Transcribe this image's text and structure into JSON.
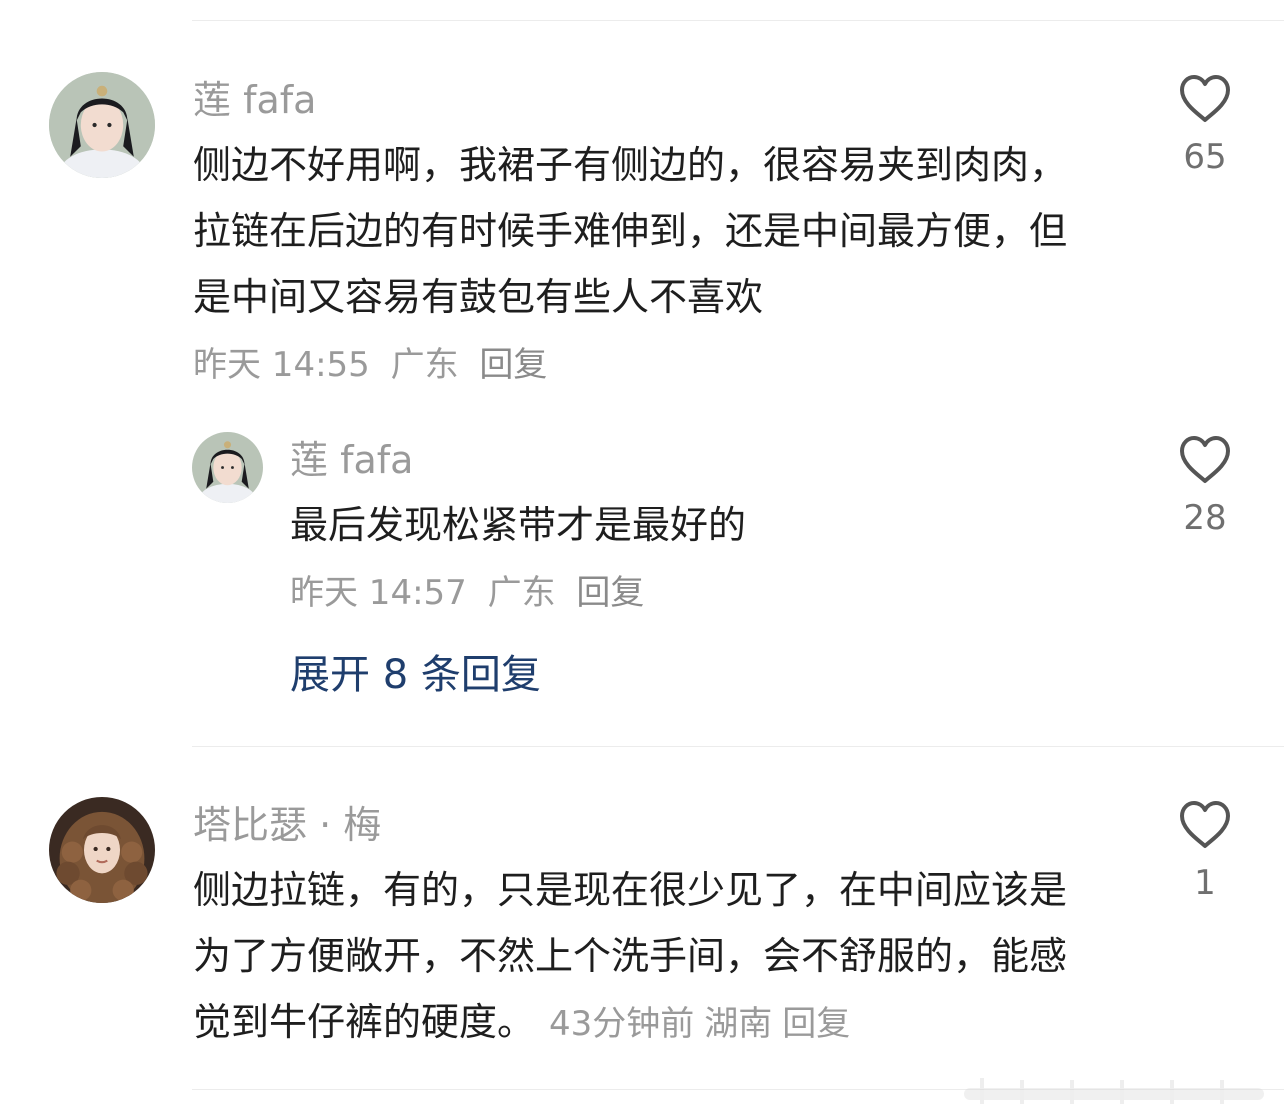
{
  "comments": [
    {
      "username": "莲 fafa",
      "text": "侧边不好用啊，我裙子有侧边的，很容易夹到肉肉，拉链在后边的有时候手难伸到，还是中间最方便，但是中间又容易有鼓包有些人不喜欢",
      "time": "昨天 14:55",
      "location": "广东",
      "reply_label": "回复",
      "likes": "65",
      "replies": [
        {
          "username": "莲 fafa",
          "text": "最后发现松紧带才是最好的",
          "time": "昨天 14:57",
          "location": "广东",
          "reply_label": "回复",
          "likes": "28"
        }
      ],
      "expand_label": "展开 8 条回复"
    },
    {
      "username": "塔比瑟 · 梅",
      "text": "侧边拉链，有的，只是现在很少见了，在中间应该是为了方便敞开，不然上个洗手间，会不舒服的，能感觉到牛仔裤的硬度。",
      "time": "43分钟前",
      "location": "湖南",
      "reply_label": "回复",
      "likes": "1"
    }
  ],
  "colors": {
    "name": "#9a9a9a",
    "text": "#1e1e1e",
    "meta": "#9a9a9a",
    "link": "#1f3e6d",
    "heart": "#555555"
  }
}
